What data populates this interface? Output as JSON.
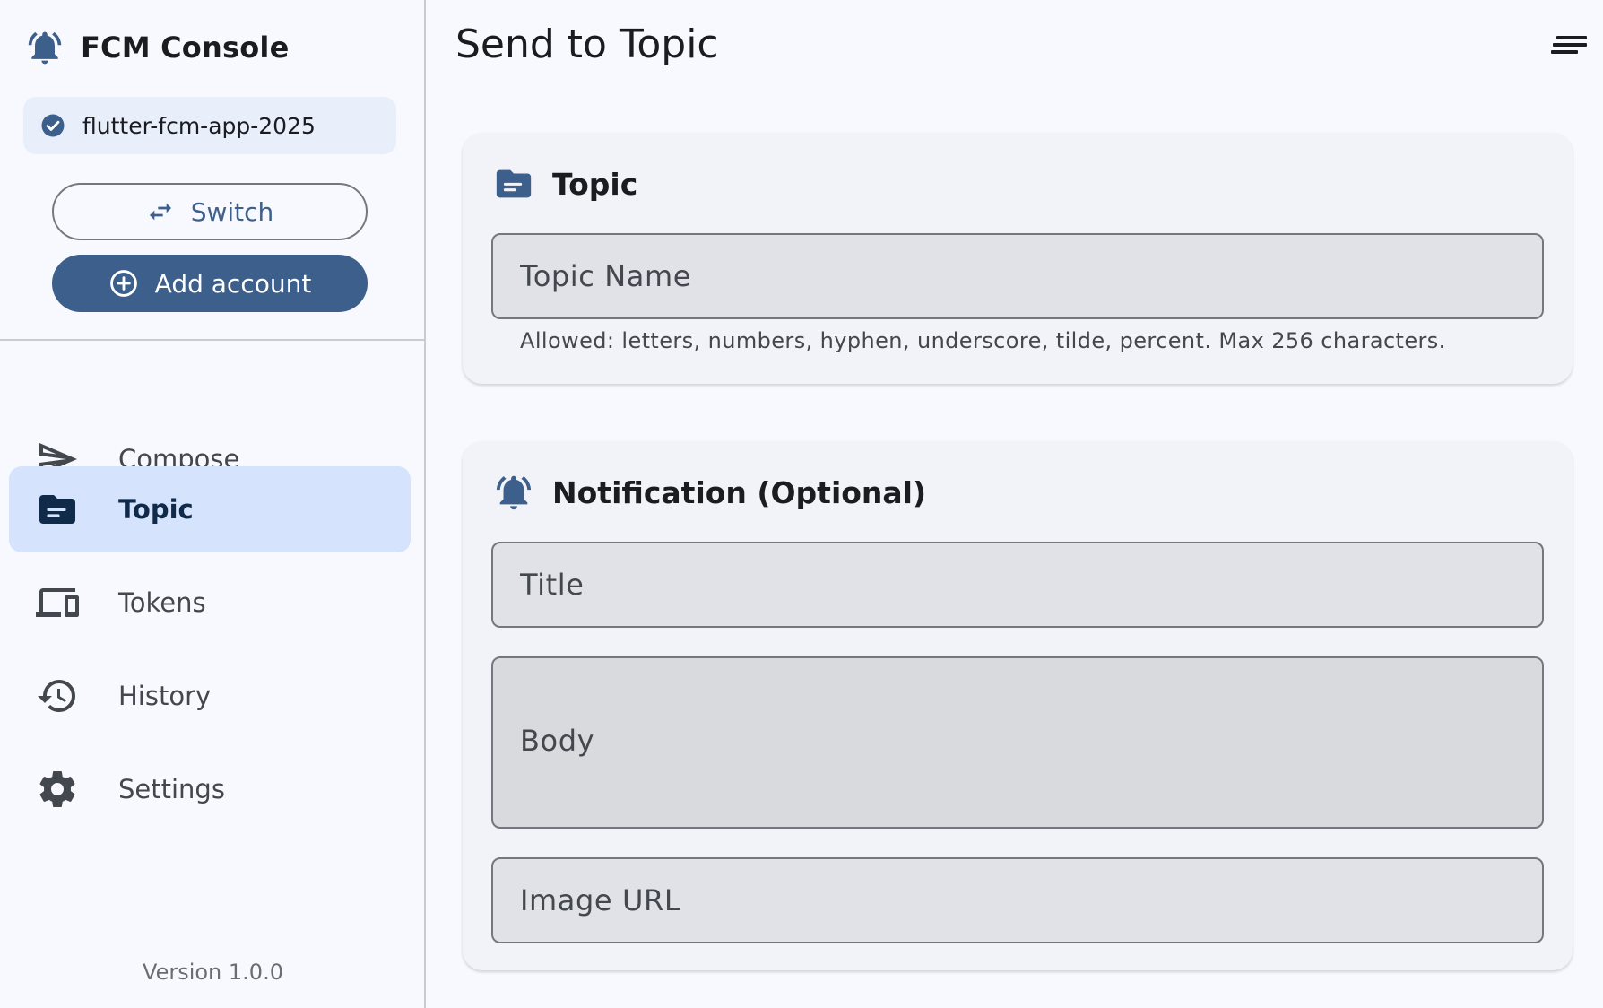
{
  "app": {
    "title": "FCM Console",
    "brand_icon": "bell-icon"
  },
  "project": {
    "name": "flutter-fcm-app-2025",
    "status_icon": "check-circle-icon"
  },
  "sidebar": {
    "switch_label": "Switch",
    "add_account_label": "Add account",
    "items": [
      {
        "label": "Compose",
        "icon": "send-icon",
        "active": false
      },
      {
        "label": "Topic",
        "icon": "topic-folder-icon",
        "active": true
      },
      {
        "label": "Tokens",
        "icon": "devices-icon",
        "active": false
      },
      {
        "label": "History",
        "icon": "history-icon",
        "active": false
      },
      {
        "label": "Settings",
        "icon": "gear-icon",
        "active": false
      }
    ],
    "version": "Version 1.0.0"
  },
  "main": {
    "title": "Send to Topic",
    "menu_icon": "menu-icon",
    "topic_section": {
      "title": "Topic",
      "icon": "topic-folder-icon",
      "topic_name_placeholder": "Topic Name",
      "helper": "Allowed: letters, numbers, hyphen, underscore, tilde, percent. Max 256 characters."
    },
    "notification_section": {
      "title": "Notification (Optional)",
      "icon": "bell-icon",
      "title_placeholder": "Title",
      "body_placeholder": "Body",
      "image_url_placeholder": "Image URL"
    }
  },
  "colors": {
    "primary": "#3d5f8b",
    "active_nav": "#d5e3fc",
    "chip": "#e9eefb",
    "background": "#f8f9fe",
    "card": "#f2f3f8"
  }
}
